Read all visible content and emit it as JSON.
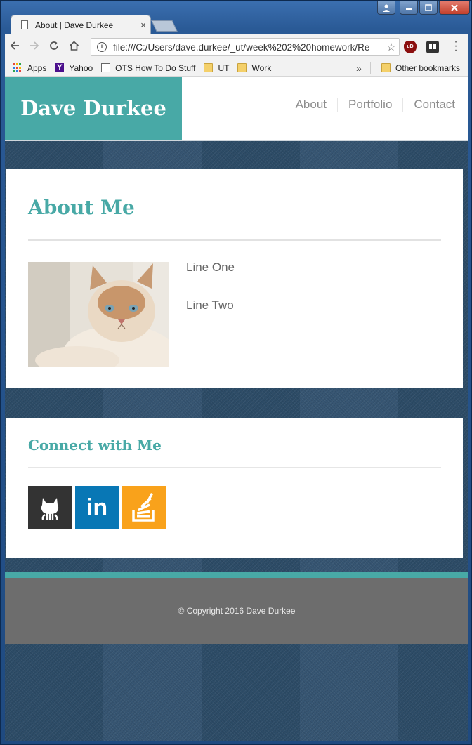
{
  "browser": {
    "tab_title": "About | Dave Durkee",
    "tab_close": "×",
    "url": "file:///C:/Users/dave.durkee/_ut/week%202%20homework/Re",
    "extension_ublock": "uD",
    "bookmarks": [
      {
        "label": "Apps",
        "icon": "apps-icon"
      },
      {
        "label": "Yahoo",
        "icon": "yahoo-icon"
      },
      {
        "label": "OTS How To Do Stuff",
        "icon": "page-icon"
      },
      {
        "label": "UT",
        "icon": "folder-icon"
      },
      {
        "label": "Work",
        "icon": "folder-icon"
      }
    ],
    "other_bookmarks": "Other bookmarks",
    "overflow": "»"
  },
  "site": {
    "brand": "Dave Durkee",
    "nav": [
      "About",
      "Portfolio",
      "Contact"
    ],
    "about": {
      "heading": "About Me",
      "lines": [
        "Line One",
        "Line Two"
      ]
    },
    "connect": {
      "heading": "Connect with Me",
      "linkedin_glyph": "in"
    },
    "footer": "© Copyright 2016 Dave Durkee"
  },
  "colors": {
    "accent": "#48a9a6",
    "footer_bg": "#6d6d6d",
    "github": "#333333",
    "linkedin": "#0877b5",
    "stackoverflow": "#f9a21b"
  }
}
